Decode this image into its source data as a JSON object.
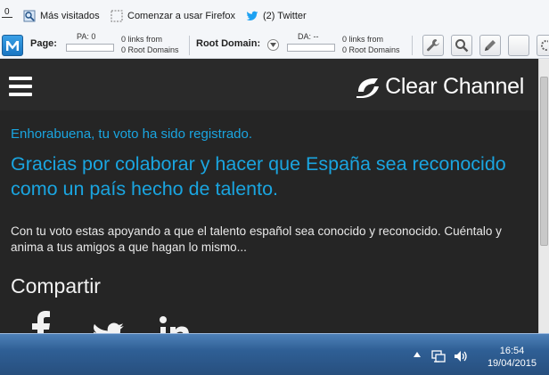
{
  "bookmarks": {
    "zero_label": "0",
    "items": [
      {
        "label": "Más visitados"
      },
      {
        "label": "Comenzar a usar Firefox"
      },
      {
        "label": "(2) Twitter"
      }
    ]
  },
  "mozbar": {
    "page_label": "Page:",
    "pa_label": "PA: 0",
    "page_links": "0 links from",
    "page_domains": "0 Root Domains",
    "root_label": "Root Domain:",
    "da_label": "DA: --",
    "root_links": "0 links from",
    "root_domains": "0 Root Domains"
  },
  "page": {
    "logo": "Clear Channel",
    "message_primary": "Enhorabuena, tu voto ha sido registrado.",
    "message_secondary": "Gracias por colaborar y hacer que España sea reconocido como un país hecho de talento.",
    "message_body": "Con tu voto estas apoyando a que el talento español sea conocido y reconocido. Cuéntalo y anima a tus amigos a que hagan lo mismo...",
    "share_heading": "Compartir"
  },
  "taskbar": {
    "time": "16:54",
    "date": "19/04/2015"
  },
  "colors": {
    "accent": "#1aa5e0",
    "page_bg": "#252525"
  }
}
